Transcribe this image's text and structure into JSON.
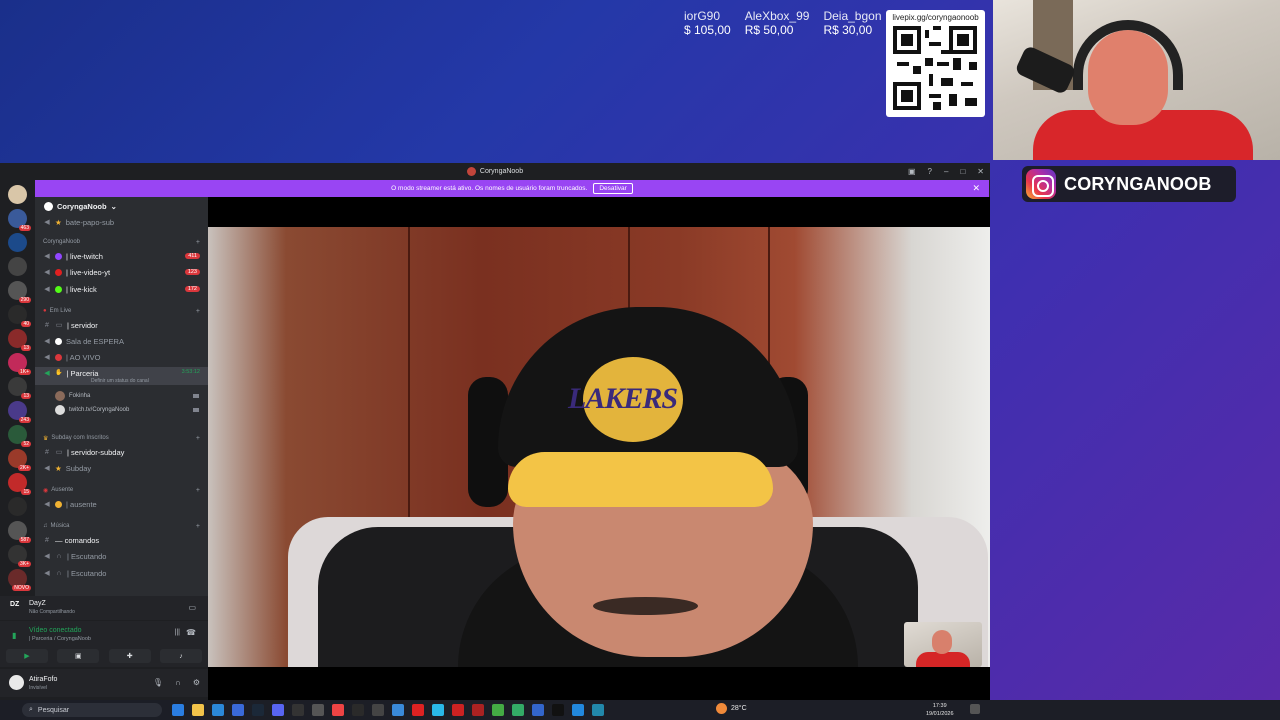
{
  "overlay": {
    "donations": [
      {
        "name": "iorG90",
        "amount": "$ 105,00"
      },
      {
        "name": "AleXbox_99",
        "amount": "R$ 50,00"
      },
      {
        "name": "Deia_bgon",
        "amount": "R$ 30,00"
      }
    ],
    "qr_url": "livepix.gg/coryngaonoob",
    "instagram_handle": "CORYNGANOOB"
  },
  "window": {
    "title": "CoryngaNoob",
    "banner_text": "O modo streamer está ativo. Os nomes de usuário foram truncados.",
    "banner_button": "Desativar"
  },
  "server": {
    "name": "CoryngaNoob",
    "top_channel": "bate-papo-sub",
    "categories": {
      "cat1": "CoryngaNoob",
      "cat2": "Em Live",
      "cat3": "Subday com Inscritos",
      "cat4": "Ausente",
      "cat5": "Música"
    },
    "channels": {
      "live_twitch": "| live-twitch",
      "live_twitch_count": "411",
      "live_video_yt": "| live-video-yt",
      "live_video_yt_count": "123",
      "live_kick": "| live-kick",
      "live_kick_count": "172",
      "servidor": "| servidor",
      "sala_espera": "Sala de ESPERA",
      "ao_vivo": "| AO VIVO",
      "parceria": "| Parceria",
      "parceria_time": "3:53:12",
      "parceria_status": "Definir um status do canal",
      "user1": "Fokinha",
      "user2": "twitch.tv/CoryngaNoob",
      "servidor_subday": "| servidor-subday",
      "subday": "Subday",
      "ausente": "| ausente",
      "comandos": "— comandos",
      "escutando1": "| Escutando",
      "escutando2": "| Escutando"
    }
  },
  "activity": {
    "game": "DayZ",
    "status": "Não Compartilhando"
  },
  "voice": {
    "status": "Vídeo conectado",
    "channel": "| Parceria / CoryngaNoob"
  },
  "user": {
    "name": "AtiraFofo",
    "status": "Invisível"
  },
  "server_badges": [
    "463",
    "290",
    "40",
    "13",
    "1K+",
    "13",
    "243",
    "52",
    "2K+",
    "15",
    "587",
    "3K+",
    "NOVO"
  ],
  "video": {
    "cap_logo": "LAKERS"
  },
  "taskbar": {
    "search": "Pesquisar",
    "weather": "28°C",
    "time": "17:39",
    "date": "19/01/2026"
  }
}
